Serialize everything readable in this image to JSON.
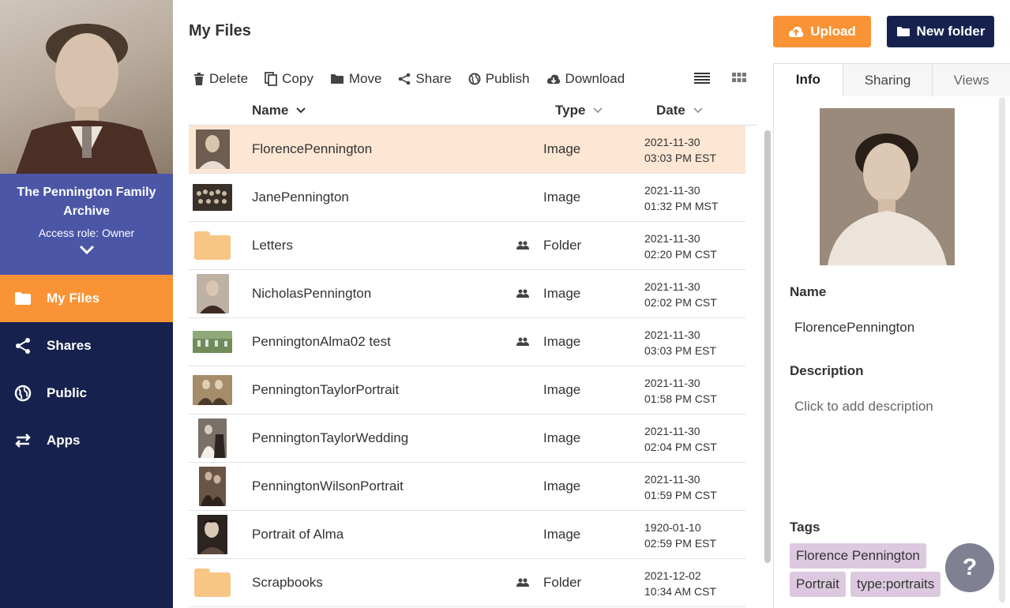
{
  "sidebar": {
    "archive_title": "The Pennington Family Archive",
    "access_role": "Access role: Owner",
    "nav": [
      {
        "label": "My Files",
        "icon": "folder-icon",
        "active": true
      },
      {
        "label": "Shares",
        "icon": "share-icon"
      },
      {
        "label": "Public",
        "icon": "globe-icon"
      },
      {
        "label": "Apps",
        "icon": "swap-arrows-icon"
      }
    ]
  },
  "header": {
    "title": "My Files",
    "upload_label": "Upload",
    "new_folder_label": "New folder"
  },
  "toolbar": {
    "delete": "Delete",
    "copy": "Copy",
    "move": "Move",
    "share": "Share",
    "publish": "Publish",
    "download": "Download"
  },
  "columns": {
    "name": "Name",
    "type": "Type",
    "date": "Date"
  },
  "files": [
    {
      "name": "FlorencePennington",
      "type": "Image",
      "date": "2021-11-30",
      "time": "03:03 PM EST",
      "shared": false,
      "selected": true
    },
    {
      "name": "JanePennington",
      "type": "Image",
      "date": "2021-11-30",
      "time": "01:32 PM MST",
      "shared": false
    },
    {
      "name": "Letters",
      "type": "Folder",
      "date": "2021-11-30",
      "time": "02:20 PM CST",
      "shared": true
    },
    {
      "name": "NicholasPennington",
      "type": "Image",
      "date": "2021-11-30",
      "time": "02:02 PM CST",
      "shared": true
    },
    {
      "name": "PenningtonAlma02 test",
      "type": "Image",
      "date": "2021-11-30",
      "time": "03:03 PM EST",
      "shared": true
    },
    {
      "name": "PenningtonTaylorPortrait",
      "type": "Image",
      "date": "2021-11-30",
      "time": "01:58 PM CST",
      "shared": false
    },
    {
      "name": "PenningtonTaylorWedding",
      "type": "Image",
      "date": "2021-11-30",
      "time": "02:04 PM CST",
      "shared": false
    },
    {
      "name": "PenningtonWilsonPortrait",
      "type": "Image",
      "date": "2021-11-30",
      "time": "01:59 PM CST",
      "shared": false
    },
    {
      "name": "Portrait of Alma",
      "type": "Image",
      "date": "1920-01-10",
      "time": "02:59 PM EST",
      "shared": false
    },
    {
      "name": "Scrapbooks",
      "type": "Folder",
      "date": "2021-12-02",
      "time": "10:34 AM CST",
      "shared": true
    }
  ],
  "panel": {
    "tabs": [
      "Info",
      "Sharing",
      "Views"
    ],
    "name_label": "Name",
    "name_value": "FlorencePennington",
    "description_label": "Description",
    "description_placeholder": "Click to add description",
    "tags_label": "Tags",
    "tags": [
      "Florence Pennington",
      "Portrait",
      "type:portraits"
    ]
  },
  "help": "?",
  "colors": {
    "navy": "#16224d",
    "orange": "#f99336",
    "archive_bg": "#4c56a6",
    "selected_row": "#fde6d4",
    "tag_bg": "#dcc8df",
    "folder": "#f7c584"
  }
}
